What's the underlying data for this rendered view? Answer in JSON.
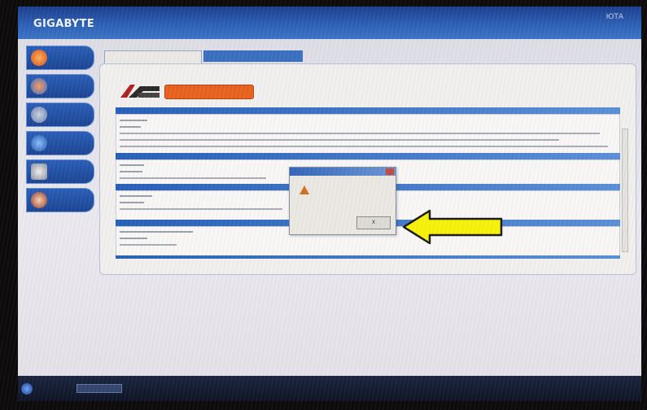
{
  "window": {
    "brand": "GIGABYTE",
    "title_right": "ЮТА"
  },
  "sidebar": {
    "items": [
      {
        "label": "",
        "icon": "flame-icon"
      },
      {
        "label": "",
        "icon": "globe-icon"
      },
      {
        "label": "",
        "icon": "tools-icon"
      },
      {
        "label": "",
        "icon": "globe-refresh-icon"
      },
      {
        "label": "",
        "icon": "chip-icon"
      },
      {
        "label": "",
        "icon": "person-icon"
      }
    ]
  },
  "tabs": {
    "active": "",
    "other": ""
  },
  "action_button": "",
  "dialog": {
    "title": "",
    "message_line1": "",
    "message_line2": "",
    "ok_label": "X"
  },
  "taskbar": {
    "tray_text": ""
  },
  "colors": {
    "titlebar": "#2f63b9",
    "sidebar": "#1c4594",
    "section_bar": "#2860b8",
    "action_button": "#e9621f",
    "arrow": "#f8f20a"
  }
}
